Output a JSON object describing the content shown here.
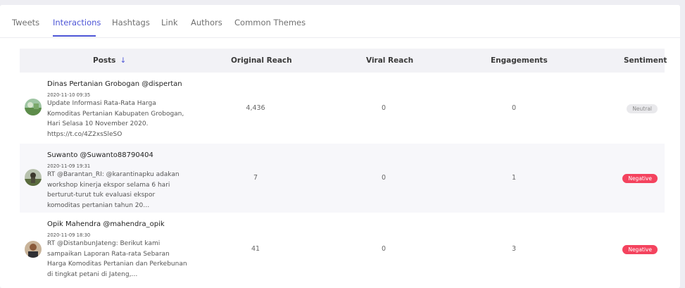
{
  "tabs": [
    {
      "label": "Tweets",
      "active": false
    },
    {
      "label": "Interactions",
      "active": true
    },
    {
      "label": "Hashtags",
      "active": false
    },
    {
      "label": "Link",
      "active": false
    },
    {
      "label": "Authors",
      "active": false
    },
    {
      "label": "Common Themes",
      "active": false
    }
  ],
  "table": {
    "columns": {
      "posts": "Posts",
      "original_reach": "Original Reach",
      "viral_reach": "Viral Reach",
      "engagements": "Engagements",
      "sentiment": "Sentiment"
    },
    "sort_icon": "arrow-down-icon",
    "rows": [
      {
        "author": "Dinas Pertanian Grobogan @dispertan",
        "timestamp": "2020-11-10 09:35",
        "text": "Update Informasi Rata-Rata Harga Komoditas Pertanian Kabupaten Grobogan, Hari Selasa 10 November 2020. https://t.co/4Z2xsSleSO",
        "original_reach": "4,436",
        "viral_reach": "0",
        "engagements": "0",
        "sentiment": "Neutral"
      },
      {
        "author": "Suwanto @Suwanto88790404",
        "timestamp": "2020-11-09 19:31",
        "text": "RT @Barantan_RI: @karantinapku adakan workshop kinerja ekspor selama 6 hari berturut-turut tuk evaluasi ekspor komoditas pertanian tahun 20…",
        "original_reach": "7",
        "viral_reach": "0",
        "engagements": "1",
        "sentiment": "Negative"
      },
      {
        "author": "Opik Mahendra @mahendra_opik",
        "timestamp": "2020-11-09 18:30",
        "text": "RT @DistanbunJateng: Berikut kami sampaikan Laporan Rata-rata Sebaran Harga Komoditas Pertanian dan Perkebunan di tingkat petani di Jateng,…",
        "original_reach": "41",
        "viral_reach": "0",
        "engagements": "3",
        "sentiment": "Negative"
      }
    ]
  },
  "colors": {
    "accent": "#4d55d6",
    "negative": "#f4435e",
    "neutral": "#e9e9ec"
  }
}
